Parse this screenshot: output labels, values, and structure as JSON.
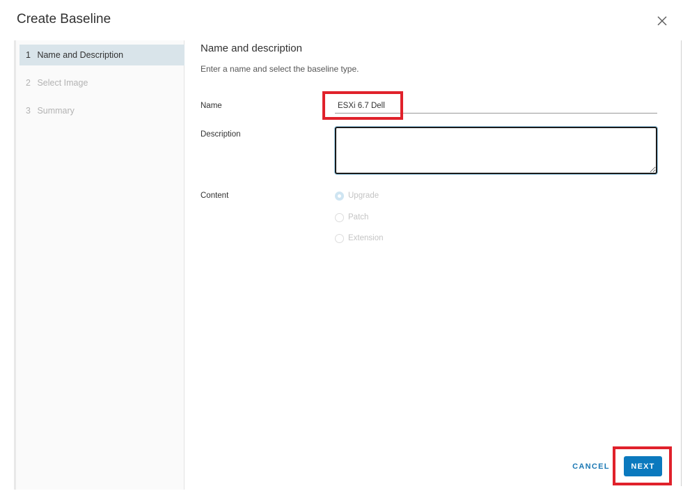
{
  "dialog": {
    "title": "Create Baseline",
    "close_icon": "close-icon"
  },
  "wizard": {
    "steps": [
      {
        "number": "1",
        "label": "Name and Description",
        "active": true
      },
      {
        "number": "2",
        "label": "Select Image",
        "active": false
      },
      {
        "number": "3",
        "label": "Summary",
        "active": false
      }
    ]
  },
  "form": {
    "section_title": "Name and description",
    "section_subtitle": "Enter a name and select the baseline type.",
    "name_label": "Name",
    "name_value": "ESXi 6.7 Dell",
    "description_label": "Description",
    "description_value": "",
    "content_label": "Content",
    "content_options": [
      {
        "label": "Upgrade",
        "selected": true
      },
      {
        "label": "Patch",
        "selected": false
      },
      {
        "label": "Extension",
        "selected": false
      }
    ]
  },
  "footer": {
    "cancel_label": "CANCEL",
    "next_label": "NEXT"
  },
  "colors": {
    "highlight": "#e0212b",
    "primary": "#0b79be",
    "active_step_bg": "#d9e4ea"
  }
}
